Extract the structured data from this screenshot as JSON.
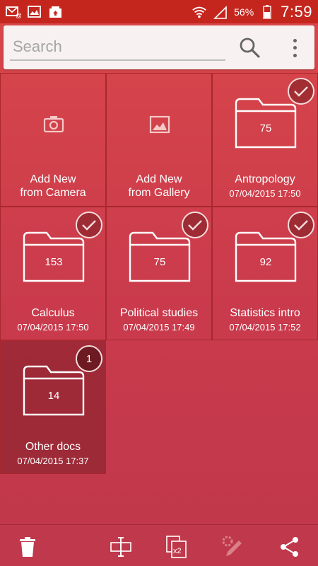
{
  "status_bar": {
    "icons_left": [
      "email-notification-icon",
      "gallery-notification-icon",
      "camera-upload-icon"
    ],
    "icons_right": [
      "wifi-icon",
      "signal-icon",
      "battery-icon"
    ],
    "battery_percent": "56%",
    "time": "7:59"
  },
  "search": {
    "placeholder": "Search",
    "value": ""
  },
  "actions": [
    {
      "title_line1": "Add New",
      "title_line2": "from Camera",
      "icon": "camera-icon"
    },
    {
      "title_line1": "Add New",
      "title_line2": "from Gallery",
      "icon": "image-icon"
    }
  ],
  "folders": [
    {
      "name": "Antropology",
      "count": "75",
      "date": "07/04/2015 17:50",
      "checked": true
    },
    {
      "name": "Calculus",
      "count": "153",
      "date": "07/04/2015 17:50",
      "checked": true
    },
    {
      "name": "Political studies",
      "count": "75",
      "date": "07/04/2015 17:49",
      "checked": true
    },
    {
      "name": "Statistics intro",
      "count": "92",
      "date": "07/04/2015 17:52",
      "checked": true
    },
    {
      "name": "Other docs",
      "count": "14",
      "date": "07/04/2015 17:37",
      "checked": false,
      "selected": true,
      "badge": "1"
    }
  ],
  "toolbar": {
    "buttons": [
      "trash-icon",
      "rename-icon",
      "duplicate-x2-icon",
      "edit-settings-icon",
      "share-icon"
    ]
  },
  "colors": {
    "status_bar": "#c4261e",
    "background": "#d9474a",
    "tile_border": "#a8282e",
    "selected_tile": "#8f2c35"
  }
}
